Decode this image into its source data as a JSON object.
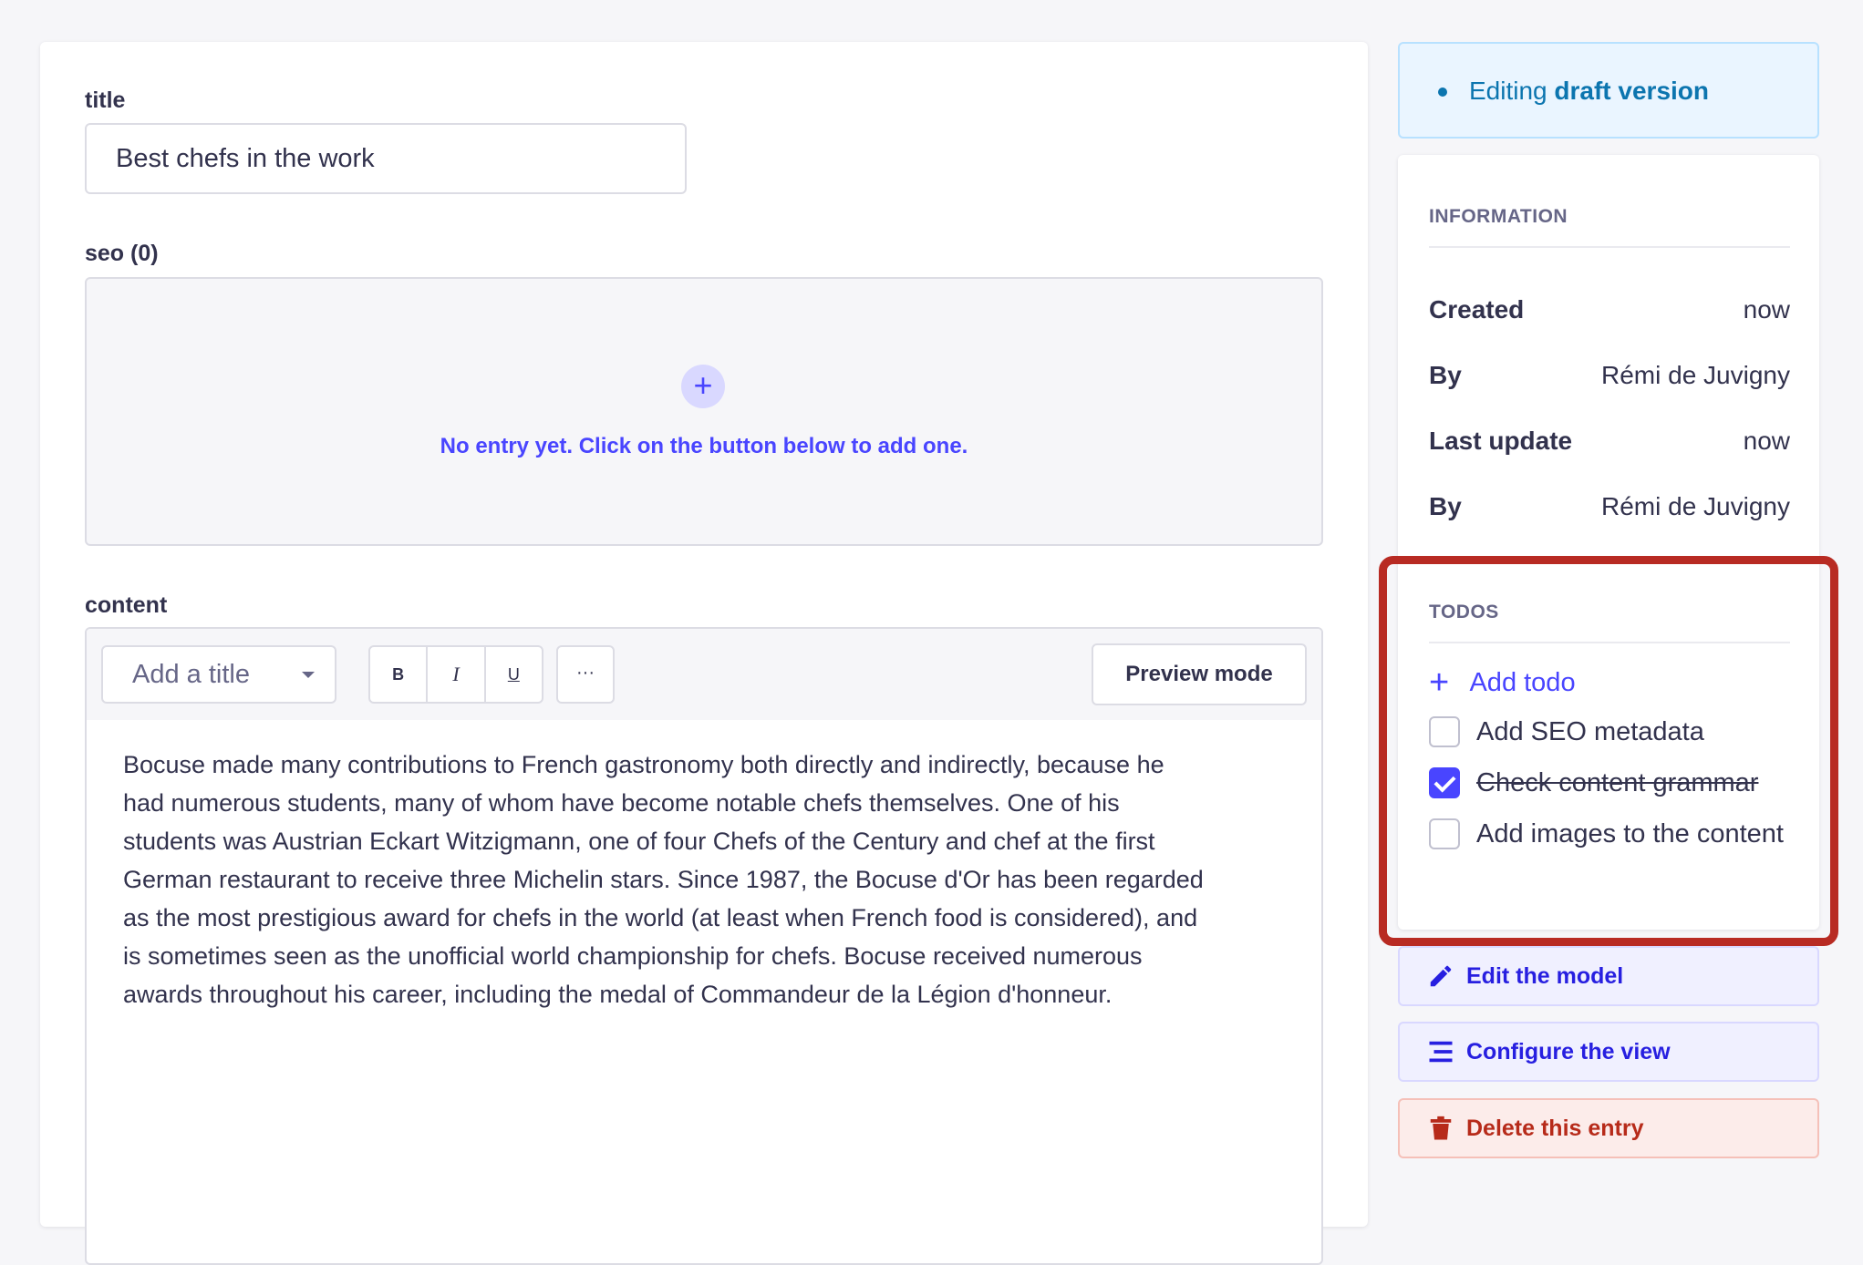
{
  "main": {
    "title_field": {
      "label": "title",
      "value": "Best chefs in the work"
    },
    "seo_field": {
      "label": "seo (0)",
      "empty_message": "No entry yet. Click on the button below to add one.",
      "add_icon": "plus-icon"
    },
    "content_field": {
      "label": "content",
      "toolbar": {
        "heading_select": "Add a title",
        "bold": "B",
        "italic": "I",
        "underline": "U",
        "more": "···",
        "preview": "Preview mode"
      },
      "text_lines": [
        "Bocuse made many contributions to French gastronomy both directly and indirectly, because he",
        "had numerous students, many of whom have become notable chefs themselves. One of his",
        "students was Austrian Eckart Witzigmann, one of four Chefs of the Century and chef at the first",
        "German restaurant to receive three Michelin stars. Since 1987, the Bocuse d'Or has been regarded",
        "as the most prestigious award for chefs in the world (at least when French food is considered), and",
        "is sometimes seen as the unofficial world championship for chefs. Bocuse received numerous",
        "awards throughout his career, including the medal of Commandeur de la Légion d'honneur."
      ]
    }
  },
  "sidebar": {
    "status": {
      "prefix": "Editing",
      "emphasis": "draft version"
    },
    "information": {
      "heading": "INFORMATION",
      "rows": [
        {
          "key": "Created",
          "value": "now"
        },
        {
          "key": "By",
          "value": "Rémi de Juvigny"
        },
        {
          "key": "Last update",
          "value": "now"
        },
        {
          "key": "By",
          "value": "Rémi de Juvigny"
        }
      ]
    },
    "todos": {
      "heading": "TODOS",
      "add_label": "Add todo",
      "items": [
        {
          "label": "Add SEO metadata",
          "checked": false
        },
        {
          "label": "Check content grammar",
          "checked": true
        },
        {
          "label": "Add images to the content",
          "checked": false
        }
      ]
    },
    "actions": {
      "edit_model": "Edit the model",
      "configure_view": "Configure the view",
      "delete_entry": "Delete this entry"
    }
  },
  "colors": {
    "primary": "#4945ff",
    "highlight": "#b82b23",
    "danger": "#b72b1a",
    "status": "#0c75af"
  }
}
